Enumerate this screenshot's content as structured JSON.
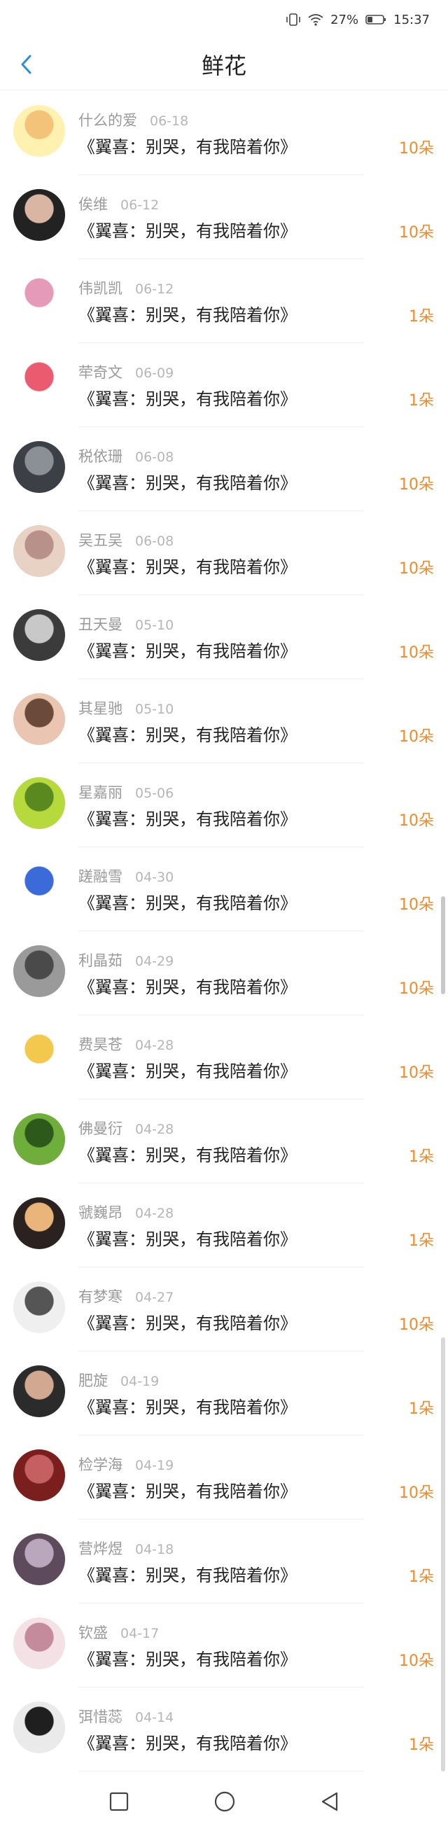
{
  "status_bar": {
    "battery_percent": "27%",
    "time": "15:37"
  },
  "header": {
    "title": "鲜花",
    "back_icon": "chevron-left-icon"
  },
  "colors": {
    "accent": "#f08a2b",
    "back": "#2b8fe0"
  },
  "items": [
    {
      "name": "什么的爱",
      "date": "06-18",
      "gift": "《翼喜：别哭，有我陪着你》",
      "count": "10朵"
    },
    {
      "name": "俟维",
      "date": "06-12",
      "gift": "《翼喜：别哭，有我陪着你》",
      "count": "10朵"
    },
    {
      "name": "伟凯凯",
      "date": "06-12",
      "gift": "《翼喜：别哭，有我陪着你》",
      "count": "1朵"
    },
    {
      "name": "荦奇文",
      "date": "06-09",
      "gift": "《翼喜：别哭，有我陪着你》",
      "count": "1朵"
    },
    {
      "name": "税依珊",
      "date": "06-08",
      "gift": "《翼喜：别哭，有我陪着你》",
      "count": "10朵"
    },
    {
      "name": "吴五吴",
      "date": "06-08",
      "gift": "《翼喜：别哭，有我陪着你》",
      "count": "10朵"
    },
    {
      "name": "丑天曼",
      "date": "05-10",
      "gift": "《翼喜：别哭，有我陪着你》",
      "count": "10朵"
    },
    {
      "name": "其星驰",
      "date": "05-10",
      "gift": "《翼喜：别哭，有我陪着你》",
      "count": "10朵"
    },
    {
      "name": "星嘉丽",
      "date": "05-06",
      "gift": "《翼喜：别哭，有我陪着你》",
      "count": "10朵"
    },
    {
      "name": "蹉融雪",
      "date": "04-30",
      "gift": "《翼喜：别哭，有我陪着你》",
      "count": "10朵"
    },
    {
      "name": "利晶茹",
      "date": "04-29",
      "gift": "《翼喜：别哭，有我陪着你》",
      "count": "10朵"
    },
    {
      "name": "费昊苍",
      "date": "04-28",
      "gift": "《翼喜：别哭，有我陪着你》",
      "count": "10朵"
    },
    {
      "name": "佛曼衍",
      "date": "04-28",
      "gift": "《翼喜：别哭，有我陪着你》",
      "count": "1朵"
    },
    {
      "name": "虢巍昂",
      "date": "04-28",
      "gift": "《翼喜：别哭，有我陪着你》",
      "count": "1朵"
    },
    {
      "name": "有梦寒",
      "date": "04-27",
      "gift": "《翼喜：别哭，有我陪着你》",
      "count": "10朵"
    },
    {
      "name": "肥旋",
      "date": "04-19",
      "gift": "《翼喜：别哭，有我陪着你》",
      "count": "1朵"
    },
    {
      "name": "检学海",
      "date": "04-19",
      "gift": "《翼喜：别哭，有我陪着你》",
      "count": "10朵"
    },
    {
      "name": "营烨煜",
      "date": "04-18",
      "gift": "《翼喜：别哭，有我陪着你》",
      "count": "1朵"
    },
    {
      "name": "钦盛",
      "date": "04-17",
      "gift": "《翼喜：别哭，有我陪着你》",
      "count": "10朵"
    },
    {
      "name": "弭惜蕊",
      "date": "04-14",
      "gift": "《翼喜：别哭，有我陪着你》",
      "count": "1朵"
    }
  ],
  "nav_bar": {
    "icons": [
      "recent-apps-icon",
      "home-icon",
      "back-triangle-icon"
    ]
  }
}
